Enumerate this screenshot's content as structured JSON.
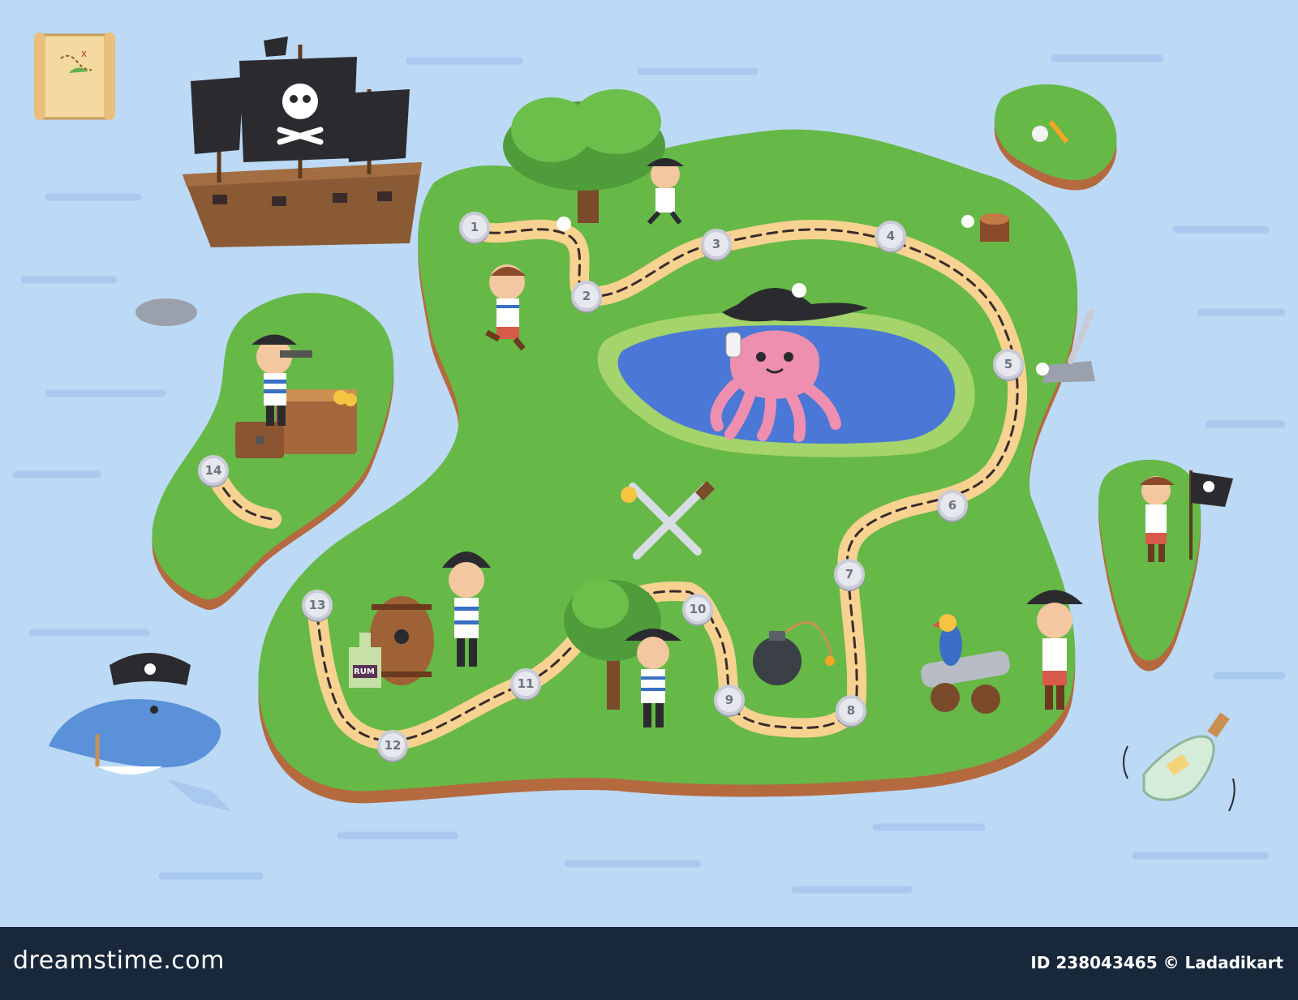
{
  "board": {
    "steps": [
      "1",
      "2",
      "3",
      "4",
      "5",
      "6",
      "7",
      "8",
      "9",
      "10",
      "11",
      "12",
      "13",
      "14"
    ],
    "barrel_label": "RUM",
    "colors": {
      "sea": "#bcd9f5",
      "grass": "#66b847",
      "cliff": "#b5693f",
      "path": "#f7d291",
      "pond": "#4b78d6",
      "octopus": "#ef8fb0",
      "ship_hull": "#8a5a35",
      "sail": "#2b2b2f"
    },
    "icons": [
      "treasure-map-icon",
      "pirate-ship-icon",
      "octopus-icon",
      "shark-icon",
      "bomb-icon",
      "cannon-icon",
      "parrot-icon",
      "treasure-chest-icon",
      "crossed-swords-icon",
      "message-bottle-icon",
      "pirate-flag-icon",
      "barrel-icon"
    ]
  },
  "footer": {
    "brand": "dreamstime.com",
    "credit": "ID 238043465 © Ladadikart"
  }
}
